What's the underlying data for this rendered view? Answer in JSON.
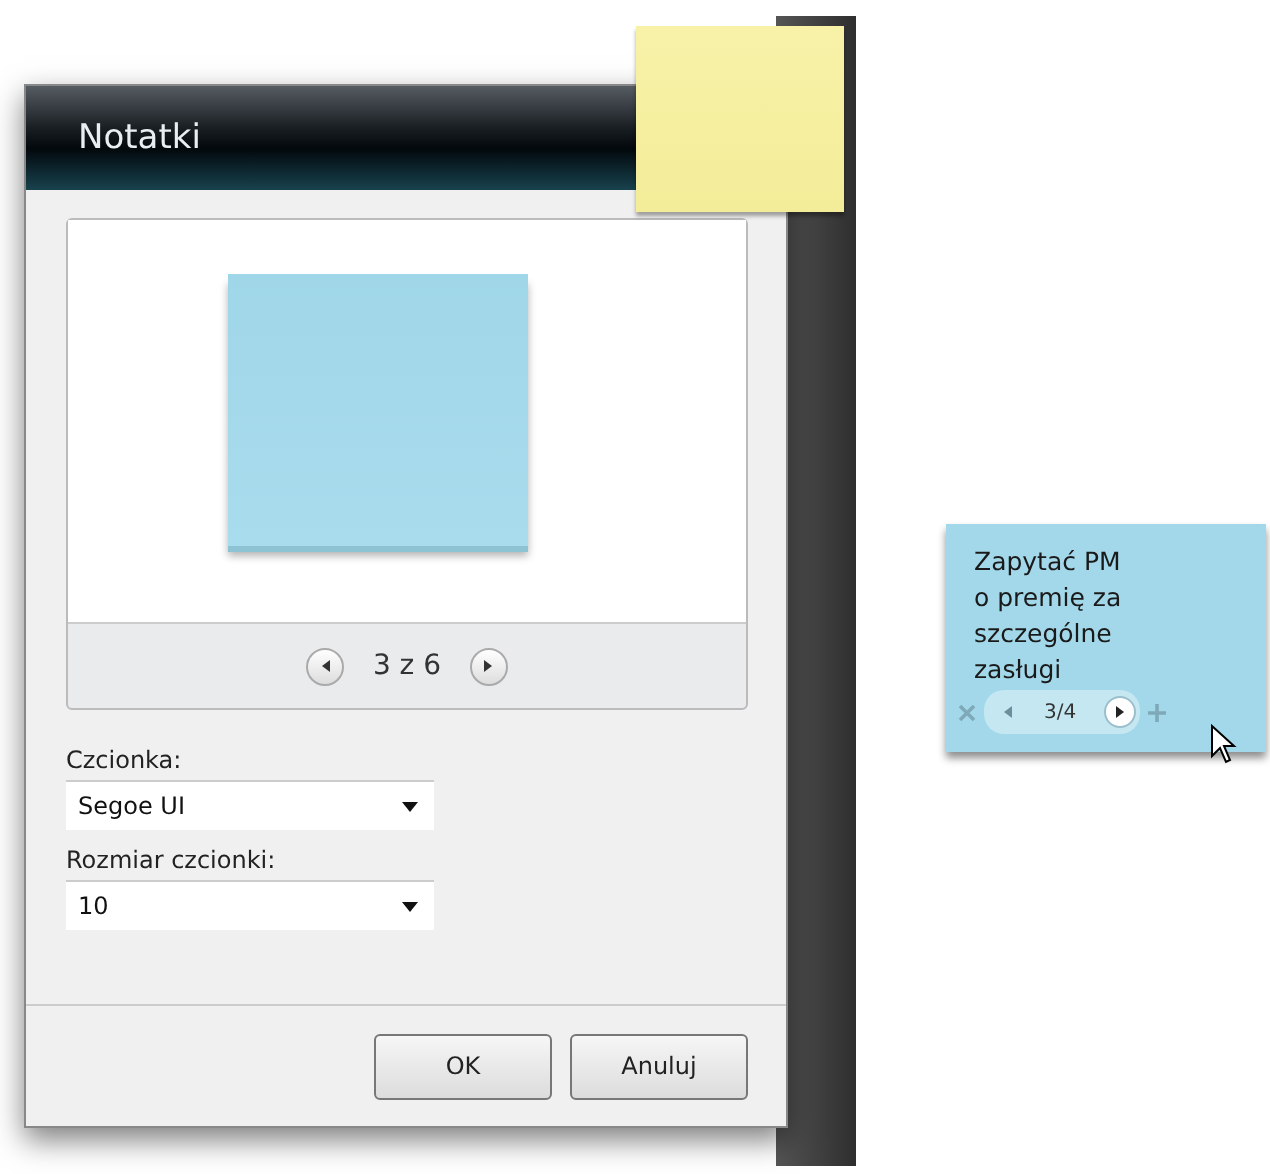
{
  "dialog": {
    "title": "Notatki",
    "preview": {
      "counter": "3 z 6"
    },
    "fields": [
      {
        "label": "Czcionka:",
        "value": "Segoe UI"
      },
      {
        "label": "Rozmiar czcionki:",
        "value": "10"
      }
    ],
    "buttons": [
      "OK",
      "Anuluj"
    ]
  },
  "note_gadget": {
    "text_lines": [
      "Zapytać PM",
      "o premię za",
      "szczególne",
      "zasługi"
    ],
    "counter": "3/4"
  }
}
